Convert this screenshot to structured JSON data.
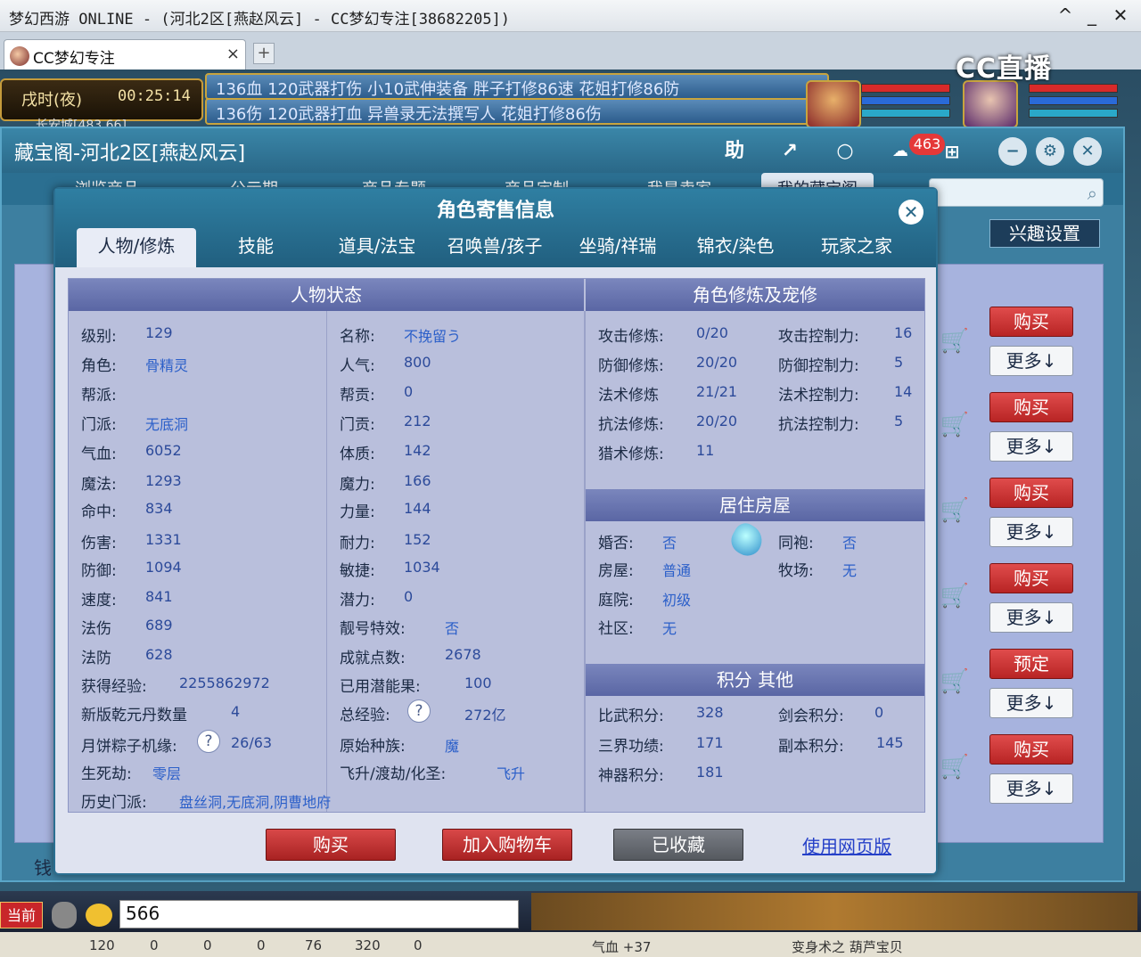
{
  "window": {
    "title": "梦幻西游 ONLINE - (河北2区[燕赵风云] - CC梦幻专注[38682205])",
    "min_symbol": "_",
    "max_symbol": "^",
    "close_symbol": "✕"
  },
  "browser": {
    "tab_label": "CC梦幻专注",
    "tab_close": "×",
    "new_tab": "+",
    "watermark": "CC直播"
  },
  "game": {
    "time_label": "戌时(夜)",
    "time_value": "00:25:14",
    "location": "长安城[483,66]",
    "ads": [
      "136血 120武器打伤 小10武伸装备 胖子打修86速 花姐打修86防",
      "136伤 120武器打血 异兽录无法撰写人 花姐打修86伤"
    ]
  },
  "main": {
    "title": "藏宝阁-河北2区[燕赵风云]",
    "help": "助",
    "share": "↗",
    "circle": "○",
    "badge": "463",
    "nav": [
      "浏览商品",
      "公示期",
      "商品专题",
      "商品定制",
      "我是卖家",
      "我的藏宝阁"
    ],
    "interest": "兴趣设置",
    "buy": [
      "购买",
      "购买",
      "购买",
      "购买",
      "预定",
      "购买"
    ],
    "more": "更多↓"
  },
  "dialog": {
    "title": "角色寄售信息",
    "close": "✕",
    "tabs": [
      "人物/修炼",
      "技能",
      "道具/法宝",
      "召唤兽/孩子",
      "坐骑/祥瑞",
      "锦衣/染色",
      "玩家之家"
    ],
    "status_header": "人物状态",
    "cultivation_header": "角色修炼及宠修",
    "housing_header": "居住房屋",
    "score_header": "积分 其他",
    "left_col": [
      {
        "k": "级别:",
        "v": "129"
      },
      {
        "k": "角色:",
        "v": "骨精灵"
      },
      {
        "k": "帮派:",
        "v": ""
      },
      {
        "k": "门派:",
        "v": "无底洞"
      },
      {
        "k": "气血:",
        "v": "6052"
      },
      {
        "k": "魔法:",
        "v": "1293"
      },
      {
        "k": "命中:",
        "v": "834"
      },
      {
        "k": "伤害:",
        "v": "1331"
      },
      {
        "k": "防御:",
        "v": "1094"
      },
      {
        "k": "速度:",
        "v": "841"
      },
      {
        "k": "法伤",
        "v": "689"
      },
      {
        "k": "法防",
        "v": "628"
      },
      {
        "k": "获得经验:",
        "v": "2255862972"
      },
      {
        "k": "新版乾元丹数量",
        "v": "4"
      },
      {
        "k": "月饼粽子机缘:",
        "v": "26/63"
      },
      {
        "k": "生死劫:",
        "v": "零层"
      },
      {
        "k": "历史门派:",
        "v": "盘丝洞,无底洞,阴曹地府"
      }
    ],
    "mid_col": [
      {
        "k": "名称:",
        "v": "不挽留う"
      },
      {
        "k": "人气:",
        "v": "800"
      },
      {
        "k": "帮贡:",
        "v": "0"
      },
      {
        "k": "门贡:",
        "v": "212"
      },
      {
        "k": "体质:",
        "v": "142"
      },
      {
        "k": "魔力:",
        "v": "166"
      },
      {
        "k": "力量:",
        "v": "144"
      },
      {
        "k": "耐力:",
        "v": "152"
      },
      {
        "k": "敏捷:",
        "v": "1034"
      },
      {
        "k": "潜力:",
        "v": "0"
      },
      {
        "k": "靓号特效:",
        "v": "否"
      },
      {
        "k": "成就点数:",
        "v": "2678"
      },
      {
        "k": "已用潜能果:",
        "v": "100"
      },
      {
        "k": "总经验:",
        "v": "272亿"
      },
      {
        "k": "原始种族:",
        "v": "魔"
      },
      {
        "k": "飞升/渡劫/化圣:",
        "v": "飞升"
      }
    ],
    "cult": [
      {
        "k": "攻击修炼:",
        "v": "0/20",
        "k2": "攻击控制力:",
        "v2": "16"
      },
      {
        "k": "防御修炼:",
        "v": "20/20",
        "k2": "防御控制力:",
        "v2": "5"
      },
      {
        "k": "法术修炼",
        "v": "21/21",
        "k2": "法术控制力:",
        "v2": "14"
      },
      {
        "k": "抗法修炼:",
        "v": "20/20",
        "k2": "抗法控制力:",
        "v2": "5"
      },
      {
        "k": "猎术修炼:",
        "v": "11",
        "k2": "",
        "v2": ""
      }
    ],
    "house": [
      {
        "k": "婚否:",
        "v": "否",
        "k2": "同袍:",
        "v2": "否"
      },
      {
        "k": "房屋:",
        "v": "普通",
        "k2": "牧场:",
        "v2": "无"
      },
      {
        "k": "庭院:",
        "v": "初级",
        "k2": "",
        "v2": ""
      },
      {
        "k": "社区:",
        "v": "无",
        "k2": "",
        "v2": ""
      }
    ],
    "score": [
      {
        "k": "比武积分:",
        "v": "328",
        "k2": "剑会积分:",
        "v2": "0"
      },
      {
        "k": "三界功绩:",
        "v": "171",
        "k2": "副本积分:",
        "v2": "145"
      },
      {
        "k": "神器积分:",
        "v": "181",
        "k2": "",
        "v2": ""
      }
    ],
    "q": "?",
    "buttons": {
      "buy": "购买",
      "cart": "加入购物车",
      "fav": "已收藏",
      "web": "使用网页版"
    }
  },
  "bottom": {
    "channel": "当前",
    "chat_value": "566",
    "money_label": "钱",
    "status": [
      "120",
      "0",
      "0",
      "0",
      "76",
      "320",
      "0",
      "气血 +37",
      "变身术之 葫芦宝贝"
    ]
  }
}
